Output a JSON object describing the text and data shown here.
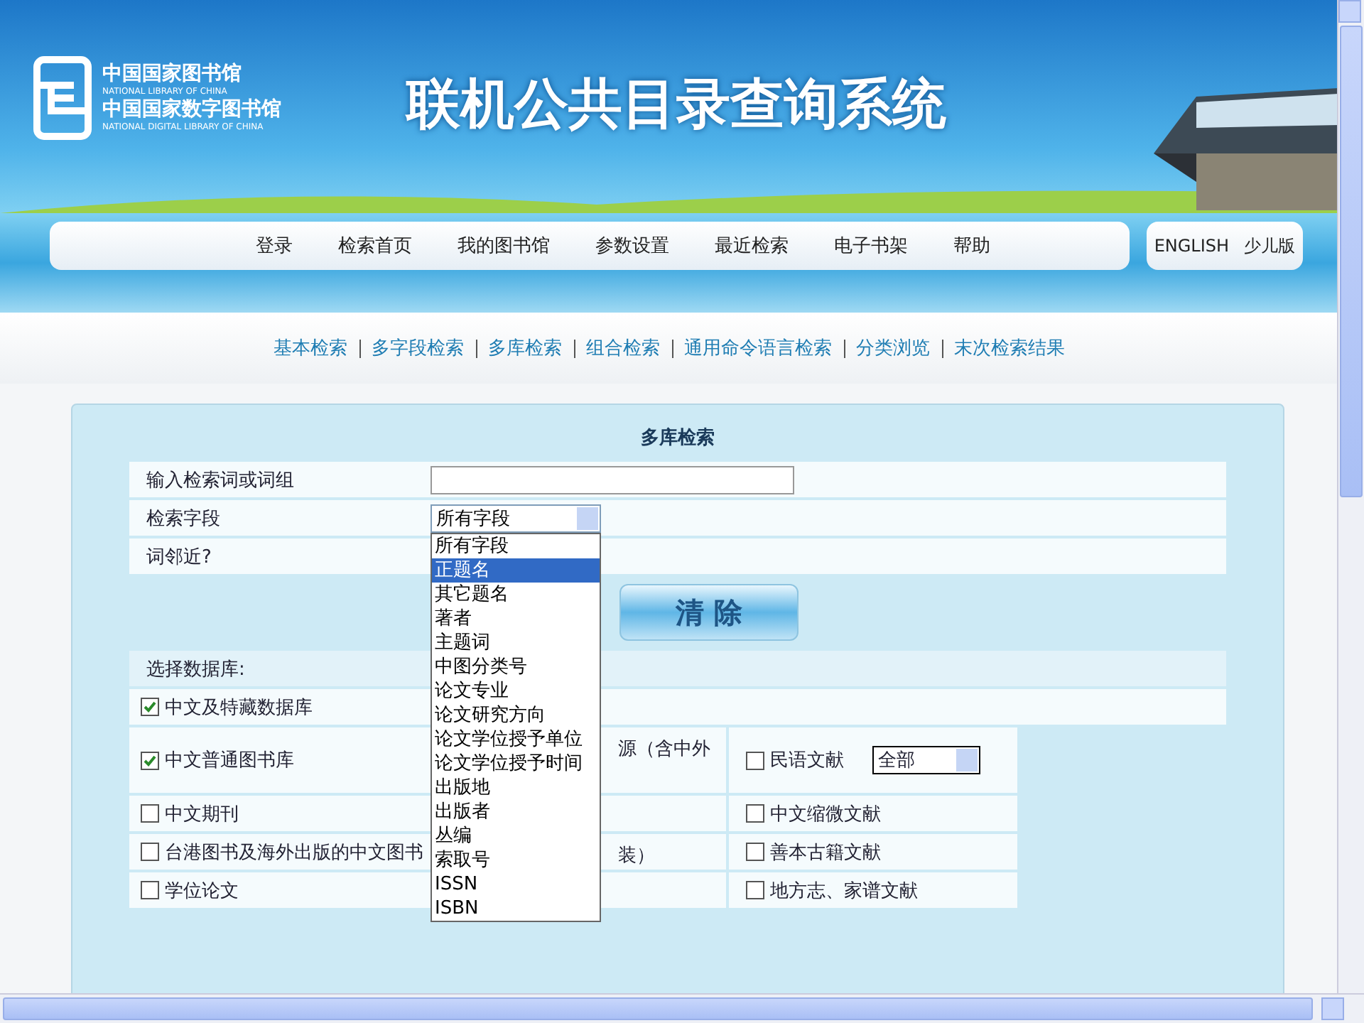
{
  "header": {
    "logos": [
      {
        "cn": "中国国家图书馆",
        "en": "NATIONAL LIBRARY OF CHINA"
      },
      {
        "cn": "中国国家数字图书馆",
        "en": "NATIONAL DIGITAL LIBRARY OF CHINA"
      }
    ],
    "title": "联机公共目录查询系统",
    "nav": [
      "登录",
      "检索首页",
      "我的图书馆",
      "参数设置",
      "最近检索",
      "电子书架",
      "帮助"
    ],
    "lang_links": [
      "ENGLISH",
      "少儿版"
    ]
  },
  "search_modes": [
    "基本检索",
    "多字段检索",
    "多库检索",
    "组合检索",
    "通用命令语言检索",
    "分类浏览",
    "末次检索结果"
  ],
  "panel": {
    "title": "多库检索",
    "fields": [
      {
        "kind": "text",
        "label": "输入检索词或词组"
      },
      {
        "kind": "select",
        "label": "检索字段",
        "value": "所有字段"
      },
      {
        "kind": "plain",
        "label": "词邻近?"
      }
    ],
    "dropdown": {
      "options": [
        {
          "label": "所有字段",
          "selected": false
        },
        {
          "label": "正题名",
          "selected": true
        },
        {
          "label": "其它题名",
          "selected": false
        },
        {
          "label": "著者",
          "selected": false
        },
        {
          "label": "主题词",
          "selected": false
        },
        {
          "label": "中图分类号",
          "selected": false
        },
        {
          "label": "论文专业",
          "selected": false
        },
        {
          "label": "论文研究方向",
          "selected": false
        },
        {
          "label": "论文学位授予单位",
          "selected": false
        },
        {
          "label": "论文学位授予时间",
          "selected": false
        },
        {
          "label": "出版地",
          "selected": false
        },
        {
          "label": "出版者",
          "selected": false
        },
        {
          "label": "丛编",
          "selected": false
        },
        {
          "label": "索取号",
          "selected": false
        },
        {
          "label": "ISSN",
          "selected": false
        },
        {
          "label": "ISBN",
          "selected": false
        }
      ]
    },
    "buttons": [
      "清 除"
    ]
  },
  "databases": {
    "heading": "选择数据库:",
    "rows": [
      {
        "cells": [
          {
            "kind": "checkbox",
            "label": "中文及特藏数据库",
            "checked": true
          }
        ]
      },
      {
        "cells": [
          {
            "kind": "checkbox",
            "label": "中文普通图书库",
            "checked": true
          },
          {
            "kind": "text",
            "label": "源（含中外"
          },
          {
            "kind": "checkbox_select",
            "label": "民语文献",
            "checked": false,
            "value": "全部"
          }
        ]
      },
      {
        "cells": [
          {
            "kind": "checkbox",
            "label": "中文期刊",
            "checked": false
          },
          {
            "kind": "blank"
          },
          {
            "kind": "checkbox",
            "label": "中文缩微文献",
            "checked": false
          }
        ]
      },
      {
        "cells": [
          {
            "kind": "checkbox",
            "label": "台港图书及海外出版的中文图书",
            "checked": false
          },
          {
            "kind": "text",
            "label": "装）"
          },
          {
            "kind": "checkbox",
            "label": "善本古籍文献",
            "checked": false
          }
        ]
      },
      {
        "cells": [
          {
            "kind": "checkbox",
            "label": "学位论文",
            "checked": false
          },
          {
            "kind": "blank"
          },
          {
            "kind": "checkbox",
            "label": "地方志、家谱文献",
            "checked": false
          }
        ]
      }
    ]
  }
}
